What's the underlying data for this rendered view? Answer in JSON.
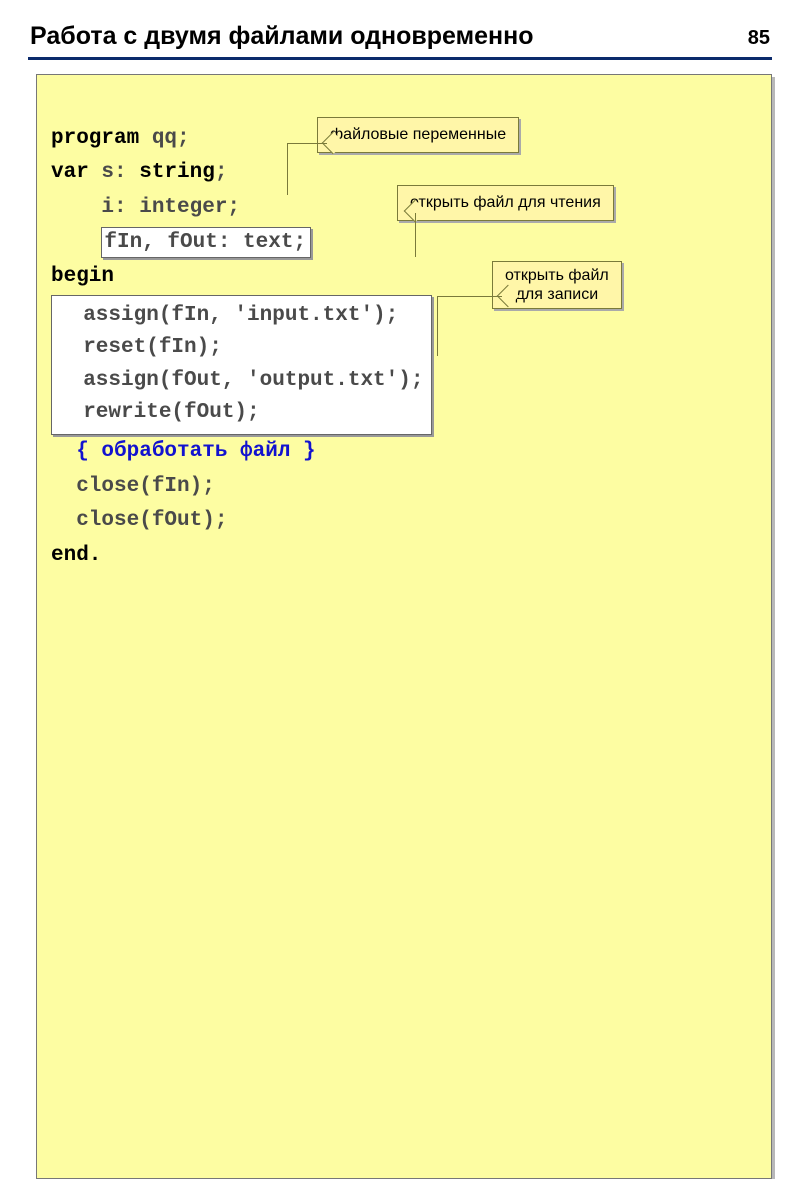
{
  "pageNumber": "85",
  "title": "Работа с двумя файлами одновременно",
  "code": {
    "l1a": "program",
    "l1b": " qq;",
    "l2a": "var",
    "l2b": " s: ",
    "l2c": "string",
    "l2d": ";",
    "l3a": "    i: integer;",
    "l4a": "    ",
    "l4b": "fIn, fOut: text;",
    "l5a": "begin",
    "l6a": "  assign(fIn, 'input.txt');",
    "l6b": "  reset(fIn);",
    "l6c": "  assign(fOut, 'output.txt');",
    "l6d": "  rewrite(fOut);",
    "l7a": "  ",
    "l7b": "{ обработать файл }",
    "l8a": "  close(fIn); ",
    "l8b": "  close(fOut);",
    "l9a": "end."
  },
  "callouts": {
    "c1": "файловые переменные",
    "c2": "открыть файл для чтения",
    "c3a": "открыть файл",
    "c3b": "для записи"
  }
}
